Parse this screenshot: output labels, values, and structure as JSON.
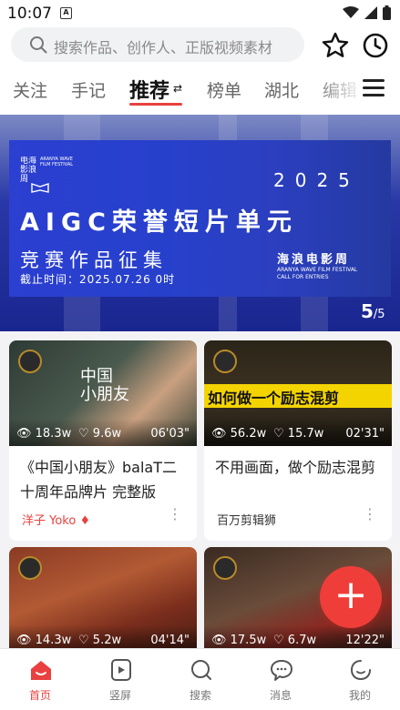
{
  "status_bar": {
    "time": "10:07",
    "notification_icon": "A"
  },
  "search": {
    "placeholder": "搜索作品、创作人、正版视频素材"
  },
  "tabs": [
    {
      "label": "关注"
    },
    {
      "label": "手记"
    },
    {
      "label": "推荐",
      "active": true
    },
    {
      "label": "榜单"
    },
    {
      "label": "湖北"
    },
    {
      "label": "编辑"
    }
  ],
  "banner": {
    "logo_cn": "电海\n影浪\n周",
    "logo_en": "ARANYA WAVE FILM FESTIVAL",
    "year": "2025",
    "title": "AIGC荣誉短片单元",
    "subtitle": "竞赛作品征集",
    "deadline": "截止时间：2025.07.26 0时",
    "festival_cn": "海浪电影周",
    "festival_en": "ARANYA WAVE FILM FESTIVAL\nCALL FOR ENTRIES",
    "page_current": "5",
    "page_total": "/5"
  },
  "cards": [
    {
      "views": "18.3w",
      "likes": "9.6w",
      "duration": "06'03\"",
      "title": "《中国小朋友》balaT二十周年品牌片 完整版",
      "author": "洋子 Yoko",
      "author_color": "#e8413f",
      "thumb_text": "中国\n小朋友"
    },
    {
      "views": "56.2w",
      "likes": "15.7w",
      "duration": "02'31\"",
      "title": "不用画面，做个励志混剪",
      "author": "百万剪辑狮",
      "author_color": "#333333",
      "thumb_text": "如何做一个励志混剪"
    },
    {
      "views": "14.3w",
      "likes": "5.2w",
      "duration": "04'14\""
    },
    {
      "views": "17.5w",
      "likes": "6.7w",
      "duration": "12'22\""
    }
  ],
  "nav": [
    {
      "label": "首页",
      "icon": "home-icon",
      "active": true
    },
    {
      "label": "竖屏",
      "icon": "vertical-video-icon"
    },
    {
      "label": "搜索",
      "icon": "search-icon"
    },
    {
      "label": "消息",
      "icon": "message-icon"
    },
    {
      "label": "我的",
      "icon": "profile-icon"
    }
  ],
  "colors": {
    "accent": "#e8413f",
    "banner_blue": "#2740cc",
    "fab": "#ef3e3a"
  }
}
